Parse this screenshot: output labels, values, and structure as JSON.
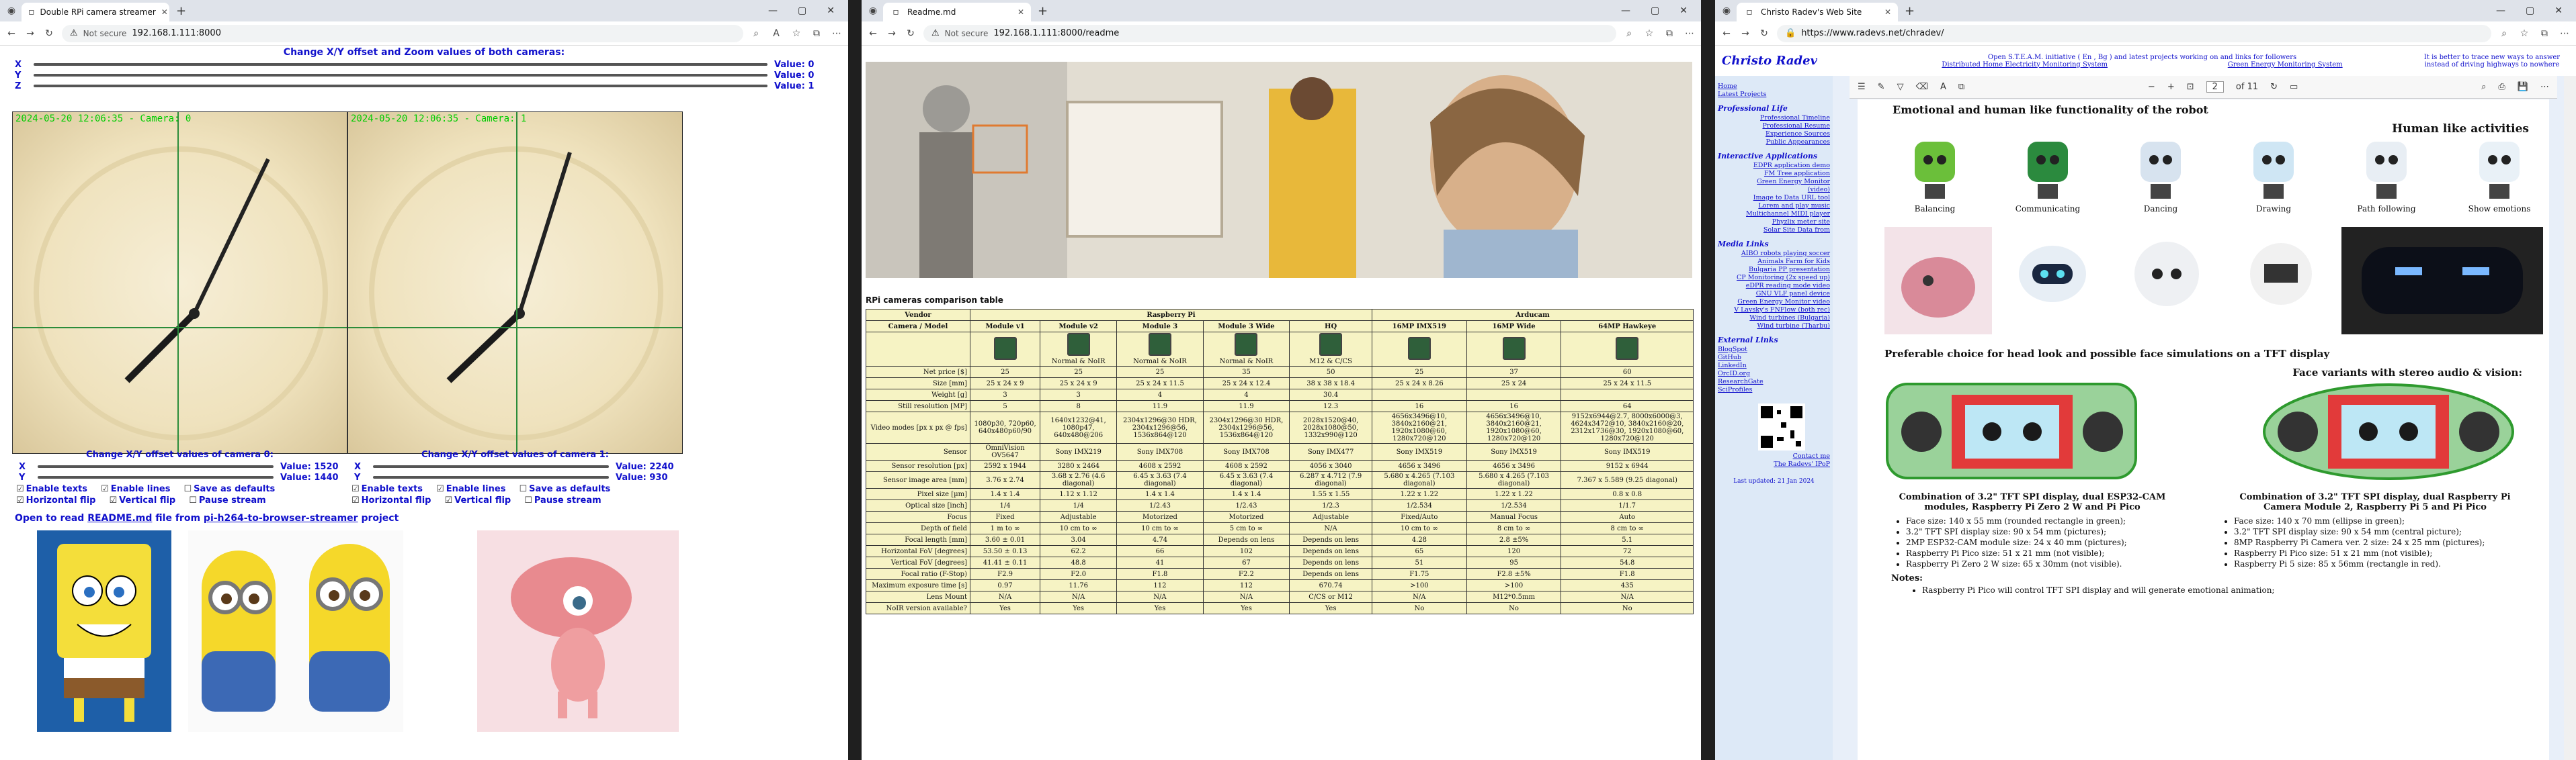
{
  "win1": {
    "tab_title": "Double RPi camera streamer",
    "url": "192.168.1.111:8000",
    "not_secure": "Not secure",
    "zoom_header": "Change X/Y offset and Zoom values of both cameras:",
    "sliders": [
      {
        "label": "X",
        "value_text": "Value: 0"
      },
      {
        "label": "Y",
        "value_text": "Value: 0"
      },
      {
        "label": "Z",
        "value_text": "Value: 1"
      }
    ],
    "cam0_ts": "2024-05-20 12:06:35 - Camera: 0",
    "cam1_ts": "2024-05-20 12:06:35 - Camera: 1",
    "cam0_header": "Change X/Y offset values of camera 0:",
    "cam1_header": "Change X/Y offset values of camera 1:",
    "cam0_x": "Value: 1520",
    "cam0_y": "Value: 1440",
    "cam1_x": "Value: 2240",
    "cam1_y": "Value: 930",
    "chk_enable_texts": "Enable texts",
    "chk_enable_lines": "Enable lines",
    "chk_save_defaults": "Save as defaults",
    "chk_hflip": "Horizontal flip",
    "chk_vflip": "Vertical flip",
    "chk_pause": "Pause stream",
    "readme_pre": "Open to read",
    "readme_link": "README.md",
    "readme_mid": "file from",
    "repo_link": "pi-h264-to-browser-streamer",
    "readme_post": "project"
  },
  "win2": {
    "tab_title": "Readme.md",
    "url": "192.168.1.111:8000/readme",
    "not_secure": "Not secure",
    "table_title": "RPi cameras comparison table",
    "vendor_label": "Vendor",
    "vendors": [
      "Raspberry Pi",
      "Arducam"
    ],
    "models": [
      "Camera / Model",
      "Module v1",
      "Module v2",
      "Module 3",
      "Module 3 Wide",
      "HQ",
      "16MP IMX519",
      "16MP Wide",
      "64MP Hawkeye"
    ],
    "rows": [
      [
        "Net price [$]",
        "25",
        "25",
        "25",
        "35",
        "50",
        "25",
        "37",
        "60"
      ],
      [
        "Size [mm]",
        "25 x 24 x 9",
        "25 x 24 x 9",
        "25 x 24 x 11.5",
        "25 x 24 x 12.4",
        "38 x 38 x 18.4",
        "25 x 24 x 8.26",
        "25 x 24",
        "25 x 24 x 11.5"
      ],
      [
        "Weight [g]",
        "3",
        "3",
        "4",
        "4",
        "30.4",
        "",
        "",
        ""
      ],
      [
        "Still resolution [MP]",
        "5",
        "8",
        "11.9",
        "11.9",
        "12.3",
        "16",
        "16",
        "64"
      ],
      [
        "Video modes [px x px @ fps]",
        "1080p30, 720p60, 640x480p60/90",
        "1640x1232@41, 1080p47, 640x480@206",
        "2304x1296@30 HDR, 2304x1296@56, 1536x864@120",
        "2304x1296@30 HDR, 2304x1296@56, 1536x864@120",
        "2028x1520@40, 2028x1080@50, 1332x990@120",
        "4656x3496@10, 3840x2160@21, 1920x1080@60, 1280x720@120",
        "4656x3496@10, 3840x2160@21, 1920x1080@60, 1280x720@120",
        "9152x6944@2.7, 8000x6000@3, 4624x3472@10, 3840x2160@20, 2312x1736@30, 1920x1080@60, 1280x720@120"
      ],
      [
        "Sensor",
        "OmniVision OV5647",
        "Sony IMX219",
        "Sony IMX708",
        "Sony IMX708",
        "Sony IMX477",
        "Sony IMX519",
        "Sony IMX519",
        "Sony IMX519"
      ],
      [
        "Sensor resolution [px]",
        "2592 x 1944",
        "3280 x 2464",
        "4608 x 2592",
        "4608 x 2592",
        "4056 x 3040",
        "4656 x 3496",
        "4656 x 3496",
        "9152 x 6944"
      ],
      [
        "Sensor image area [mm]",
        "3.76 x 2.74",
        "3.68 x 2.76 (4.6 diagonal)",
        "6.45 x 3.63 (7.4 diagonal)",
        "6.45 x 3.63 (7.4 diagonal)",
        "6.287 x 4.712 (7.9 diagonal)",
        "5.680 x 4.265 (7.103 diagonal)",
        "5.680 x 4.265 (7.103 diagonal)",
        "7.367 x 5.589 (9.25 diagonal)"
      ],
      [
        "Pixel size [µm]",
        "1.4 x 1.4",
        "1.12 x 1.12",
        "1.4 x 1.4",
        "1.4 x 1.4",
        "1.55 x 1.55",
        "1.22 x 1.22",
        "1.22 x 1.22",
        "0.8 x 0.8"
      ],
      [
        "Optical size [inch]",
        "1/4",
        "1/4",
        "1/2.43",
        "1/2.43",
        "1/2.3",
        "1/2.534",
        "1/2.534",
        "1/1.7"
      ],
      [
        "Focus",
        "Fixed",
        "Adjustable",
        "Motorized",
        "Motorized",
        "Adjustable",
        "Fixed/Auto",
        "Manual Focus",
        "Auto"
      ],
      [
        "Depth of field",
        "1 m to ∞",
        "10 cm to ∞",
        "10 cm to ∞",
        "5 cm to ∞",
        "N/A",
        "10 cm to ∞",
        "8 cm to ∞",
        "8 cm to ∞"
      ],
      [
        "Focal length [mm]",
        "3.60 ± 0.01",
        "3.04",
        "4.74",
        "Depends on lens",
        "Depends on lens",
        "4.28",
        "2.8 ±5%",
        "5.1"
      ],
      [
        "Horizontal FoV [degrees]",
        "53.50 ± 0.13",
        "62.2",
        "66",
        "102",
        "Depends on lens",
        "65",
        "120",
        "72"
      ],
      [
        "Vertical FoV [degrees]",
        "41.41 ± 0.11",
        "48.8",
        "41",
        "67",
        "Depends on lens",
        "51",
        "95",
        "54.8"
      ],
      [
        "Focal ratio (F-Stop)",
        "F2.9",
        "F2.0",
        "F1.8",
        "F2.2",
        "Depends on lens",
        "F1.75",
        "F2.8 ±5%",
        "F1.8"
      ],
      [
        "Maximum exposure time [s]",
        "0.97",
        "11.76",
        "112",
        "112",
        "670.74",
        ">100",
        ">100",
        "435"
      ],
      [
        "Lens Mount",
        "N/A",
        "N/A",
        "N/A",
        "N/A",
        "C/CS or M12",
        "N/A",
        "M12*0.5mm",
        "N/A"
      ],
      [
        "NoIR version available?",
        "Yes",
        "Yes",
        "Yes",
        "Yes",
        "Yes",
        "No",
        "No",
        "No"
      ]
    ],
    "noir_note": "Normal & NoIR",
    "hq_note": "M12 & C/CS"
  },
  "win3": {
    "tab_title": "Christo Radev's Web Site",
    "url": "https://www.radevs.net/chradev/",
    "site_title": "Christo Radev",
    "hdr1": "Open S.T.E.A.M. initiative ( En , Bg ) and latest projects working on and links for followers",
    "hdr2": "It is better to trace new ways to answer instead of driving highways to nowhere",
    "hdr3": "Distributed Home Electricity Monitoring System",
    "hdr4": "Green Energy Monitoring System",
    "side_top": [
      "Home",
      "Latest Projects"
    ],
    "side_pl_title": "Professional Life",
    "side_pl": [
      "Professional Timeline",
      "Professional Resume",
      "Experience Sources",
      "Public Appearances"
    ],
    "side_ia_title": "Interactive Applications",
    "side_ia": [
      "EDPR application demo",
      "FM Tree application",
      "Green Energy Monitor",
      "(video)",
      "Image to Data URL tool",
      "Lorem and play music",
      "Multichannel MIDI player",
      "Phyzlix meter site",
      "Solar Site Data from"
    ],
    "side_ml_title": "Media Links",
    "side_ml": [
      "AIBO robots playing soccer",
      "Animals Farm for Kids",
      "Bulgaria PP presentation",
      "CP Monitoring (2x speed up)",
      "eDPR reading mode video",
      "GNU VLF panel device",
      "Green Energy Monitor video",
      "V Lavsky's FNFlow (both rec)",
      "Wind turbines (Bulgaria)",
      "Wind turbine (Tharbu)"
    ],
    "side_el_title": "External Links",
    "side_el": [
      "BlogSpot",
      "GitHub",
      "LinkedIn",
      "OrcID.org",
      "ResearchGate",
      "SciProfiles"
    ],
    "contact": "Contact me",
    "radevs": "The Radevs' IPoP",
    "last_updated": "Last updated: 21 Jan 2024",
    "pdf_page": "2",
    "pdf_of": "of 11",
    "doc_heading": "Emotional and human like functionality of the robot",
    "human_acts": "Human like activities",
    "acts": [
      "Balancing",
      "Communicating",
      "Dancing",
      "Drawing",
      "Path following",
      "Show emotions"
    ],
    "pref": "Preferable choice for head look and possible face simulations on a TFT display",
    "face_variants": "Face variants with stereo audio & vision:",
    "combo1": "Combination of 3.2\" TFT SPI display, dual ESP32-CAM modules, Raspberry Pi Zero 2 W and Pi Pico",
    "combo2": "Combination of 3.2\" TFT SPI display, dual Raspberry Pi Camera Module 2, Raspberry Pi 5 and Pi Pico",
    "list1": [
      "Face size: 140 x 55 mm (rounded rectangle in green);",
      "3.2\" TFT SPI display size: 90 x 54 mm (pictures);",
      "2MP ESP32-CAM module size: 24 x 40 mm (pictures);",
      "Raspberry Pi Pico size: 51 x 21 mm (not visible);",
      "Raspberry Pi Zero 2 W size: 65 x 30mm (not visible)."
    ],
    "list2": [
      "Face size: 140 x 70 mm (ellipse in green);",
      "3.2\" TFT SPI display size: 90 x 54 mm (central picture);",
      "8MP Raspberry Pi Camera ver. 2 size: 24 x 25 mm (pictures);",
      "Raspberry Pi Pico size: 51 x 21 mm (not visible);",
      "Raspberry Pi 5 size: 85 x 56mm (rectangle in red)."
    ],
    "notes": "Notes:",
    "note1": "Raspberry Pi Pico will control TFT SPI display and will generate emotional animation;"
  },
  "colors": {
    "link_blue": "#1010cc",
    "cross_green": "#2b8c3a",
    "table_bg": "#f6f3c4"
  }
}
